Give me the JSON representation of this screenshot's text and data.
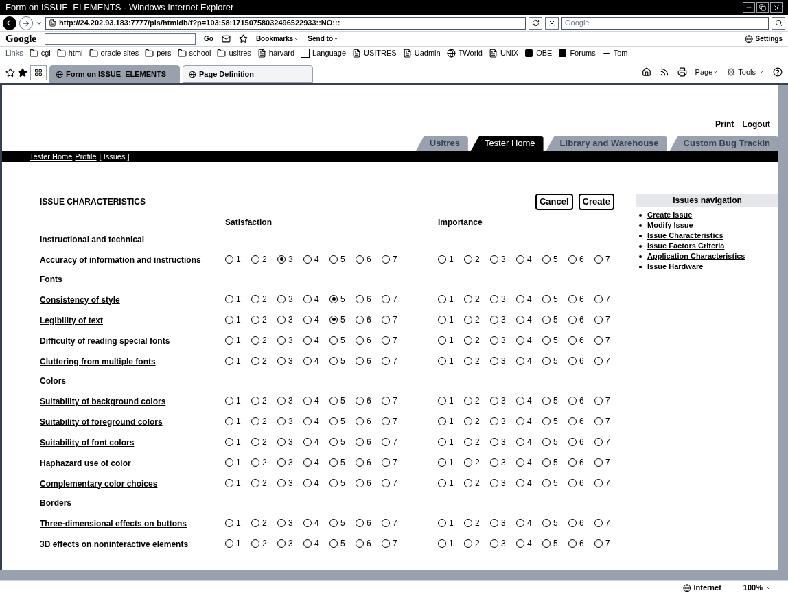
{
  "window": {
    "title": "Form on ISSUE_ELEMENTS - Windows Internet Explorer"
  },
  "address_bar": {
    "url": "http://24.202.93.183:7777/pls/htmldb/f?p=103:58:17150758032496522933::NO:::"
  },
  "search": {
    "placeholder": "Google"
  },
  "google_toolbar": {
    "logo": "Google",
    "go": "Go",
    "bookmarks": "Bookmarks",
    "send_to": "Send to",
    "settings": "Settings"
  },
  "links_bar": {
    "label": "Links",
    "items": [
      {
        "label": "cgi",
        "kind": "folder"
      },
      {
        "label": "html",
        "kind": "folder"
      },
      {
        "label": "oracle sites",
        "kind": "folder"
      },
      {
        "label": "pers",
        "kind": "folder"
      },
      {
        "label": "school",
        "kind": "folder"
      },
      {
        "label": "usitres",
        "kind": "folder"
      },
      {
        "label": "harvard",
        "kind": "page"
      },
      {
        "label": "Language",
        "kind": "search"
      },
      {
        "label": "USITRES",
        "kind": "page"
      },
      {
        "label": "Uadmin",
        "kind": "page"
      },
      {
        "label": "TWorld",
        "kind": "globe"
      },
      {
        "label": "UNIX",
        "kind": "page"
      },
      {
        "label": "OBE",
        "kind": "box"
      },
      {
        "label": "Forums",
        "kind": "box"
      },
      {
        "label": "Tom",
        "kind": "text"
      }
    ]
  },
  "browser_tabs": [
    {
      "label": "Form on ISSUE_ELEMENTS",
      "selected": true
    },
    {
      "label": "Page Definition",
      "selected": false
    }
  ],
  "command_bar": {
    "page": "Page",
    "tools": "Tools"
  },
  "page": {
    "top_links": [
      "Print",
      "Logout"
    ],
    "tabs": [
      {
        "label": "Usitres",
        "selected": false
      },
      {
        "label": "Tester Home",
        "selected": true
      },
      {
        "label": "Library and Warehouse",
        "selected": false
      },
      {
        "label": "Custom Bug Trackin",
        "selected": false
      }
    ],
    "breadcrumb": [
      {
        "label": "Tester Home",
        "current": false
      },
      {
        "label": "Profile",
        "current": false
      },
      {
        "label": "[ Issues ]",
        "current": true
      }
    ]
  },
  "form": {
    "title": "ISSUE CHARACTERISTICS",
    "buttons": [
      "Cancel",
      "Create"
    ],
    "columns": [
      "Satisfaction",
      "Importance"
    ],
    "sections": [
      {
        "title": "Instructional and technical",
        "items": [
          {
            "label": "Accuracy of information and instructions",
            "satisfaction": [
              {
                "label": "1",
                "selected": false
              },
              {
                "label": "2",
                "selected": false
              },
              {
                "label": "3",
                "selected": true
              },
              {
                "label": "4",
                "selected": false
              },
              {
                "label": "5",
                "selected": false
              },
              {
                "label": "6",
                "selected": false
              },
              {
                "label": "7",
                "selected": false
              }
            ],
            "importance": [
              {
                "label": "1",
                "selected": false
              },
              {
                "label": "2",
                "selected": false
              },
              {
                "label": "3",
                "selected": false
              },
              {
                "label": "4",
                "selected": false
              },
              {
                "label": "5",
                "selected": false
              },
              {
                "label": "6",
                "selected": false
              },
              {
                "label": "7",
                "selected": false
              }
            ]
          }
        ]
      },
      {
        "title": "Fonts",
        "items": [
          {
            "label": "Consistency of style",
            "satisfaction": [
              {
                "label": "1",
                "selected": false
              },
              {
                "label": "2",
                "selected": false
              },
              {
                "label": "3",
                "selected": false
              },
              {
                "label": "4",
                "selected": false
              },
              {
                "label": "5",
                "selected": true
              },
              {
                "label": "6",
                "selected": false
              },
              {
                "label": "7",
                "selected": false
              }
            ],
            "importance": [
              {
                "label": "1",
                "selected": false
              },
              {
                "label": "2",
                "selected": false
              },
              {
                "label": "3",
                "selected": false
              },
              {
                "label": "4",
                "selected": false
              },
              {
                "label": "5",
                "selected": false
              },
              {
                "label": "6",
                "selected": false
              },
              {
                "label": "7",
                "selected": false
              }
            ]
          },
          {
            "label": "Legibility of text",
            "satisfaction": [
              {
                "label": "1",
                "selected": false
              },
              {
                "label": "2",
                "selected": false
              },
              {
                "label": "3",
                "selected": false
              },
              {
                "label": "4",
                "selected": false
              },
              {
                "label": "5",
                "selected": true
              },
              {
                "label": "6",
                "selected": false
              },
              {
                "label": "7",
                "selected": false
              }
            ],
            "importance": [
              {
                "label": "1",
                "selected": false
              },
              {
                "label": "2",
                "selected": false
              },
              {
                "label": "3",
                "selected": false
              },
              {
                "label": "4",
                "selected": false
              },
              {
                "label": "5",
                "selected": false
              },
              {
                "label": "6",
                "selected": false
              },
              {
                "label": "7",
                "selected": false
              }
            ]
          },
          {
            "label": "Difficulty of reading special fonts",
            "satisfaction": [
              {
                "label": "1",
                "selected": false
              },
              {
                "label": "2",
                "selected": false
              },
              {
                "label": "3",
                "selected": false
              },
              {
                "label": "4",
                "selected": false
              },
              {
                "label": "5",
                "selected": false
              },
              {
                "label": "6",
                "selected": false
              },
              {
                "label": "7",
                "selected": false
              }
            ],
            "importance": [
              {
                "label": "1",
                "selected": false
              },
              {
                "label": "2",
                "selected": false
              },
              {
                "label": "3",
                "selected": false
              },
              {
                "label": "4",
                "selected": false
              },
              {
                "label": "5",
                "selected": false
              },
              {
                "label": "6",
                "selected": false
              },
              {
                "label": "7",
                "selected": false
              }
            ]
          },
          {
            "label": "Cluttering from multiple fonts",
            "satisfaction": [
              {
                "label": "1",
                "selected": false
              },
              {
                "label": "2",
                "selected": false
              },
              {
                "label": "3",
                "selected": false
              },
              {
                "label": "4",
                "selected": false
              },
              {
                "label": "5",
                "selected": false
              },
              {
                "label": "6",
                "selected": false
              },
              {
                "label": "7",
                "selected": false
              }
            ],
            "importance": [
              {
                "label": "1",
                "selected": false
              },
              {
                "label": "2",
                "selected": false
              },
              {
                "label": "3",
                "selected": false
              },
              {
                "label": "4",
                "selected": false
              },
              {
                "label": "5",
                "selected": false
              },
              {
                "label": "6",
                "selected": false
              },
              {
                "label": "7",
                "selected": false
              }
            ]
          }
        ]
      },
      {
        "title": "Colors",
        "items": [
          {
            "label": "Suitability of background colors",
            "satisfaction": [
              {
                "label": "1",
                "selected": false
              },
              {
                "label": "2",
                "selected": false
              },
              {
                "label": "3",
                "selected": false
              },
              {
                "label": "4",
                "selected": false
              },
              {
                "label": "5",
                "selected": false
              },
              {
                "label": "6",
                "selected": false
              },
              {
                "label": "7",
                "selected": false
              }
            ],
            "importance": [
              {
                "label": "1",
                "selected": false
              },
              {
                "label": "2",
                "selected": false
              },
              {
                "label": "3",
                "selected": false
              },
              {
                "label": "4",
                "selected": false
              },
              {
                "label": "5",
                "selected": false
              },
              {
                "label": "6",
                "selected": false
              },
              {
                "label": "7",
                "selected": false
              }
            ]
          },
          {
            "label": "Suitability of foreground colors",
            "satisfaction": [
              {
                "label": "1",
                "selected": false
              },
              {
                "label": "2",
                "selected": false
              },
              {
                "label": "3",
                "selected": false
              },
              {
                "label": "4",
                "selected": false
              },
              {
                "label": "5",
                "selected": false
              },
              {
                "label": "6",
                "selected": false
              },
              {
                "label": "7",
                "selected": false
              }
            ],
            "importance": [
              {
                "label": "1",
                "selected": false
              },
              {
                "label": "2",
                "selected": false
              },
              {
                "label": "3",
                "selected": false
              },
              {
                "label": "4",
                "selected": false
              },
              {
                "label": "5",
                "selected": false
              },
              {
                "label": "6",
                "selected": false
              },
              {
                "label": "7",
                "selected": false
              }
            ]
          },
          {
            "label": "Suitability of font colors",
            "satisfaction": [
              {
                "label": "1",
                "selected": false
              },
              {
                "label": "2",
                "selected": false
              },
              {
                "label": "3",
                "selected": false
              },
              {
                "label": "4",
                "selected": false
              },
              {
                "label": "5",
                "selected": false
              },
              {
                "label": "6",
                "selected": false
              },
              {
                "label": "7",
                "selected": false
              }
            ],
            "importance": [
              {
                "label": "1",
                "selected": false
              },
              {
                "label": "2",
                "selected": false
              },
              {
                "label": "3",
                "selected": false
              },
              {
                "label": "4",
                "selected": false
              },
              {
                "label": "5",
                "selected": false
              },
              {
                "label": "6",
                "selected": false
              },
              {
                "label": "7",
                "selected": false
              }
            ]
          },
          {
            "label": "Haphazard use of color",
            "satisfaction": [
              {
                "label": "1",
                "selected": false
              },
              {
                "label": "2",
                "selected": false
              },
              {
                "label": "3",
                "selected": false
              },
              {
                "label": "4",
                "selected": false
              },
              {
                "label": "5",
                "selected": false
              },
              {
                "label": "6",
                "selected": false
              },
              {
                "label": "7",
                "selected": false
              }
            ],
            "importance": [
              {
                "label": "1",
                "selected": false
              },
              {
                "label": "2",
                "selected": false
              },
              {
                "label": "3",
                "selected": false
              },
              {
                "label": "4",
                "selected": false
              },
              {
                "label": "5",
                "selected": false
              },
              {
                "label": "6",
                "selected": false
              },
              {
                "label": "7",
                "selected": false
              }
            ]
          },
          {
            "label": "Complementary color choices",
            "satisfaction": [
              {
                "label": "1",
                "selected": false
              },
              {
                "label": "2",
                "selected": false
              },
              {
                "label": "3",
                "selected": false
              },
              {
                "label": "4",
                "selected": false
              },
              {
                "label": "5",
                "selected": false
              },
              {
                "label": "6",
                "selected": false
              },
              {
                "label": "7",
                "selected": false
              }
            ],
            "importance": [
              {
                "label": "1",
                "selected": false
              },
              {
                "label": "2",
                "selected": false
              },
              {
                "label": "3",
                "selected": false
              },
              {
                "label": "4",
                "selected": false
              },
              {
                "label": "5",
                "selected": false
              },
              {
                "label": "6",
                "selected": false
              },
              {
                "label": "7",
                "selected": false
              }
            ]
          }
        ]
      },
      {
        "title": "Borders",
        "items": [
          {
            "label": "Three-dimensional effects on buttons",
            "satisfaction": [
              {
                "label": "1",
                "selected": false
              },
              {
                "label": "2",
                "selected": false
              },
              {
                "label": "3",
                "selected": false
              },
              {
                "label": "4",
                "selected": false
              },
              {
                "label": "5",
                "selected": false
              },
              {
                "label": "6",
                "selected": false
              },
              {
                "label": "7",
                "selected": false
              }
            ],
            "importance": [
              {
                "label": "1",
                "selected": false
              },
              {
                "label": "2",
                "selected": false
              },
              {
                "label": "3",
                "selected": false
              },
              {
                "label": "4",
                "selected": false
              },
              {
                "label": "5",
                "selected": false
              },
              {
                "label": "6",
                "selected": false
              },
              {
                "label": "7",
                "selected": false
              }
            ]
          },
          {
            "label": "3D effects on noninteractive elements",
            "satisfaction": [
              {
                "label": "1",
                "selected": false
              },
              {
                "label": "2",
                "selected": false
              },
              {
                "label": "3",
                "selected": false
              },
              {
                "label": "4",
                "selected": false
              },
              {
                "label": "5",
                "selected": false
              },
              {
                "label": "6",
                "selected": false
              },
              {
                "label": "7",
                "selected": false
              }
            ],
            "importance": [
              {
                "label": "1",
                "selected": false
              },
              {
                "label": "2",
                "selected": false
              },
              {
                "label": "3",
                "selected": false
              },
              {
                "label": "4",
                "selected": false
              },
              {
                "label": "5",
                "selected": false
              },
              {
                "label": "6",
                "selected": false
              },
              {
                "label": "7",
                "selected": false
              }
            ]
          }
        ]
      }
    ]
  },
  "navigation": {
    "title": "Issues navigation",
    "links": [
      "Create Issue",
      "Modify Issue",
      "Issue Characteristics",
      "Issue Factors Criteria",
      "Application Characteristics",
      "Issue Hardware"
    ]
  },
  "status_bar": {
    "zone": "Internet",
    "zoom": "100%"
  }
}
